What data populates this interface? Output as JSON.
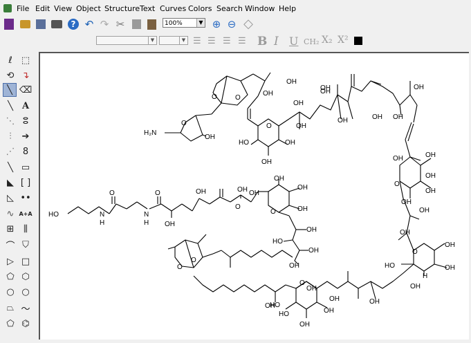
{
  "menu": {
    "items": [
      "File",
      "Edit",
      "View",
      "Object",
      "Structure",
      "Text",
      "Curves",
      "Colors",
      "Search",
      "Window",
      "Help"
    ]
  },
  "toolbar": {
    "zoom_value": "100%"
  },
  "format_toolbar": {
    "bold": "B",
    "italic": "I",
    "underline": "U",
    "formula_style": "CH₂",
    "subscript": "X₂",
    "superscript": "X²"
  },
  "palette": {
    "text_tool": "A",
    "ab_tool": "A+A",
    "icons": [
      "lasso-icon",
      "marquee-icon",
      "rotate-icon",
      "bond-arrow-icon",
      "structure-perspective-icon",
      "eraser-icon",
      "solid-bond-icon",
      "text-icon",
      "dashed-bond-icon",
      "chain-icon",
      "hashed-bond-icon",
      "arrow-icon",
      "hashed-wedge-icon",
      "orbital-icon",
      "bold-bond-icon",
      "rectangle-icon",
      "wedge-bond-icon",
      "bracket-icon",
      "hollow-wedge-icon",
      "charge-icon",
      "wavy-bond-icon",
      "mapping-icon",
      "table-icon",
      "tlc-icon",
      "chain-tool-icon",
      "stamp-icon",
      "triangle-icon",
      "square-icon",
      "pentagon-icon",
      "hexagon-icon",
      "circle-icon",
      "circle2-icon",
      "cycloheptane-icon",
      "cyclooctane-icon",
      "cyclopentadiene-icon",
      "benzene-icon"
    ]
  },
  "molecule": {
    "labels": {
      "oh": "OH",
      "h2n": "H₂N",
      "ho": "HO",
      "o": "O",
      "n": "N",
      "h": "H"
    }
  }
}
